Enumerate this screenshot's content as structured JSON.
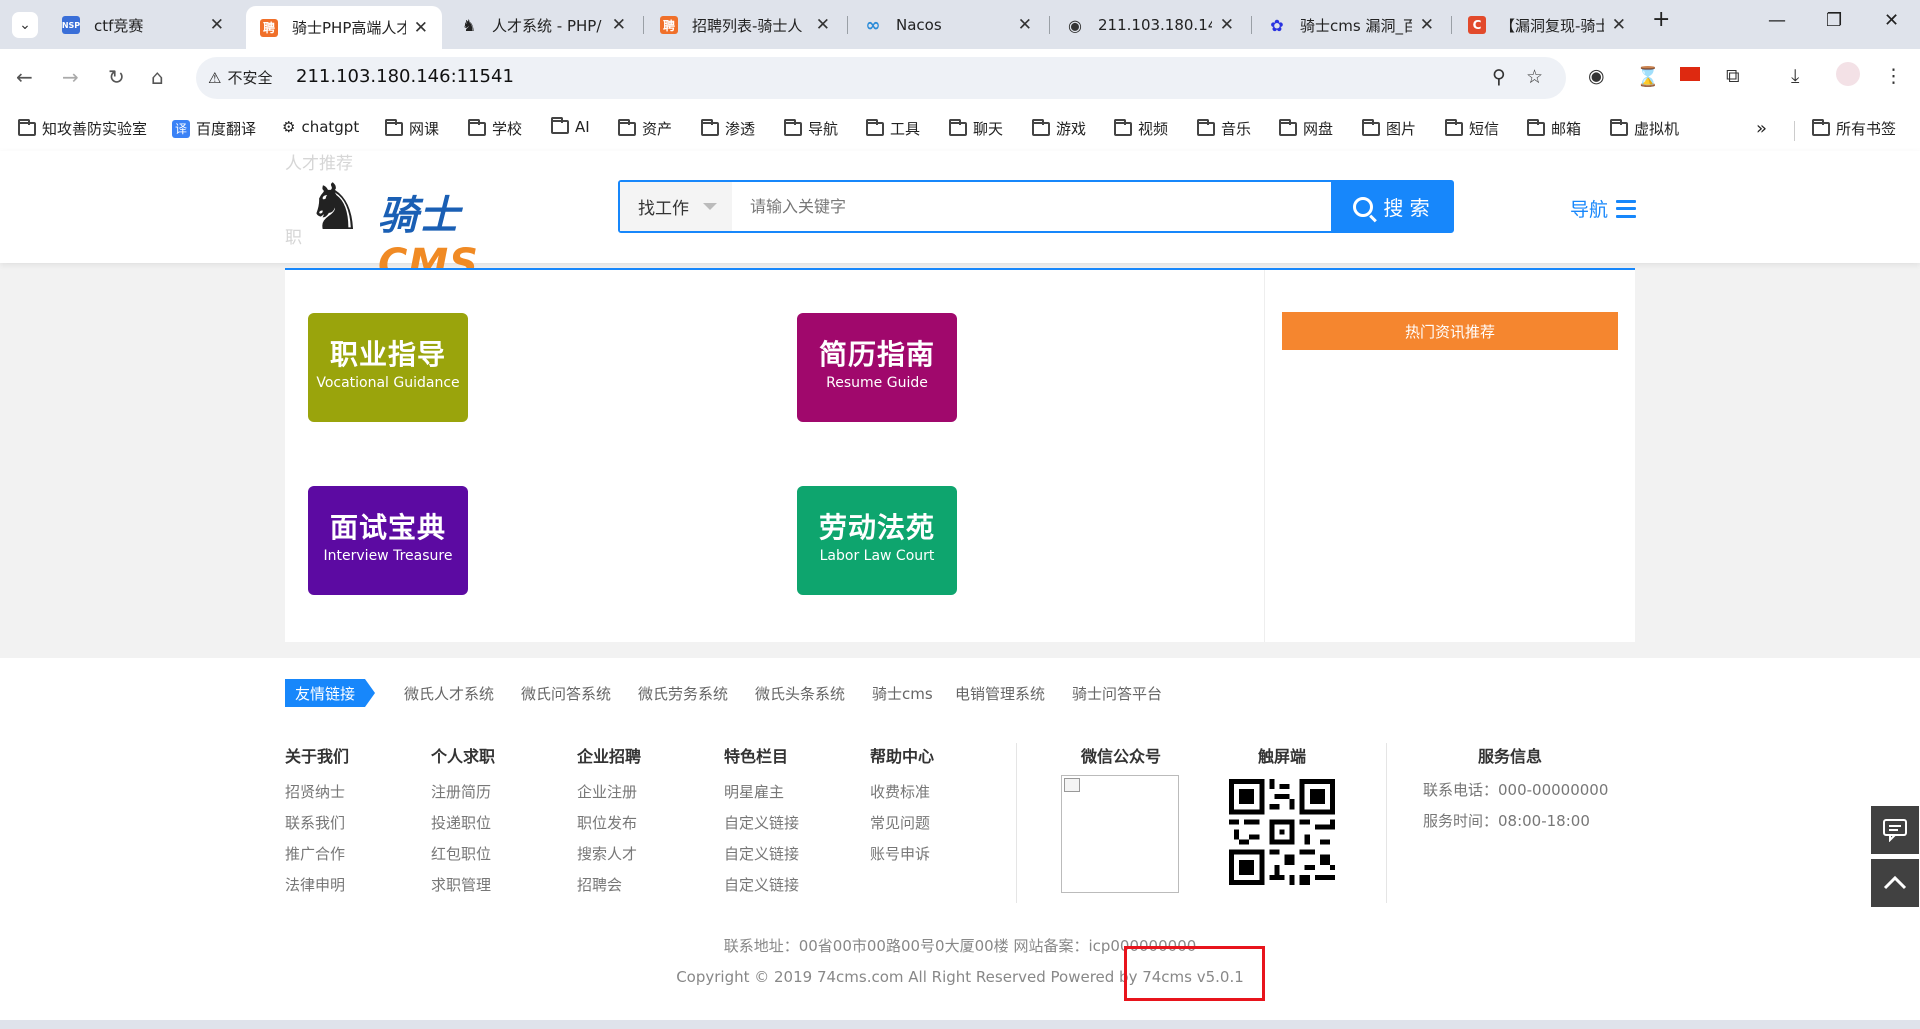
{
  "browser": {
    "tabs": [
      {
        "title": "ctf竞赛",
        "fav_text": "NSP",
        "fav_color": "#3a6fd8"
      },
      {
        "title": "骑士PHP高端人才",
        "fav_text": "聘",
        "fav_color": "#f0702a"
      },
      {
        "title": "人才系统 - PHP/",
        "fav_text": "♞",
        "fav_color": "#ffffff"
      },
      {
        "title": "招聘列表-骑士人",
        "fav_text": "聘",
        "fav_color": "#f0702a"
      },
      {
        "title": "Nacos",
        "fav_text": "∞",
        "fav_color": "#ffffff"
      },
      {
        "title": "211.103.180.14",
        "fav_text": "◉",
        "fav_color": "#ffffff"
      },
      {
        "title": "骑士cms 漏洞_百",
        "fav_text": "✿",
        "fav_color": "#ffffff"
      },
      {
        "title": "【漏洞复现-骑士",
        "fav_text": "C",
        "fav_color": "#e24a2b"
      }
    ],
    "address": {
      "warning": "不安全",
      "url": "211.103.180.146:11541"
    },
    "bookmarks": [
      "知攻善防实验室",
      "百度翻译",
      "chatgpt",
      "网课",
      "学校",
      "AI",
      "资产",
      "渗透",
      "导航",
      "工具",
      "聊天",
      "游戏",
      "视频",
      "音乐",
      "网盘",
      "图片",
      "短信",
      "邮箱",
      "虚拟机"
    ],
    "all_bookmarks": "所有书签"
  },
  "header": {
    "logo_text": "骑士",
    "logo_cms": "CMS",
    "ghost_left_1": "人才推荐",
    "ghost_left_2": "职",
    "search_type": "找工作",
    "search_placeholder": "请输入关键字",
    "search_button": "搜 索",
    "nav_label": "导航"
  },
  "content": {
    "cards": [
      {
        "cn": "职业指导",
        "en": "Vocational Guidance",
        "color": "#9aa40c"
      },
      {
        "cn": "简历指南",
        "en": "Resume Guide",
        "color": "#a0086c"
      },
      {
        "cn": "面试宝典",
        "en": "Interview Treasure",
        "color": "#5c0aa2"
      },
      {
        "cn": "劳动法苑",
        "en": "Labor Law Court",
        "color": "#0ea56e"
      }
    ],
    "hot_news": "热门资讯推荐"
  },
  "footer": {
    "friend_label": "友情链接",
    "friend_links": [
      "微氏人才系统",
      "微氏问答系统",
      "微氏劳务系统",
      "微氏头条系统",
      "骑士cms",
      "电销管理系统",
      "骑士问答平台"
    ],
    "columns": [
      {
        "title": "关于我们",
        "items": [
          "招贤纳士",
          "联系我们",
          "推广合作",
          "法律申明"
        ]
      },
      {
        "title": "个人求职",
        "items": [
          "注册简历",
          "投递职位",
          "红包职位",
          "求职管理"
        ]
      },
      {
        "title": "企业招聘",
        "items": [
          "企业注册",
          "职位发布",
          "搜索人才",
          "招聘会"
        ]
      },
      {
        "title": "特色栏目",
        "items": [
          "明星雇主",
          "自定义链接",
          "自定义链接",
          "自定义链接"
        ]
      },
      {
        "title": "帮助中心",
        "items": [
          "收费标准",
          "常见问题",
          "账号申诉"
        ]
      }
    ],
    "wechat_title": "微信公众号",
    "touch_title": "触屏端",
    "service_title": "服务信息",
    "service_phone": "联系电话：000-00000000",
    "service_time": "服务时间：08:00-18:00",
    "address": "联系地址：00省00市00路00号0大厦00楼 网站备案：icp000000000",
    "copyright": "Copyright © 2019 74cms.com All Right Reserved Powered by 74cms v5.0.1"
  }
}
